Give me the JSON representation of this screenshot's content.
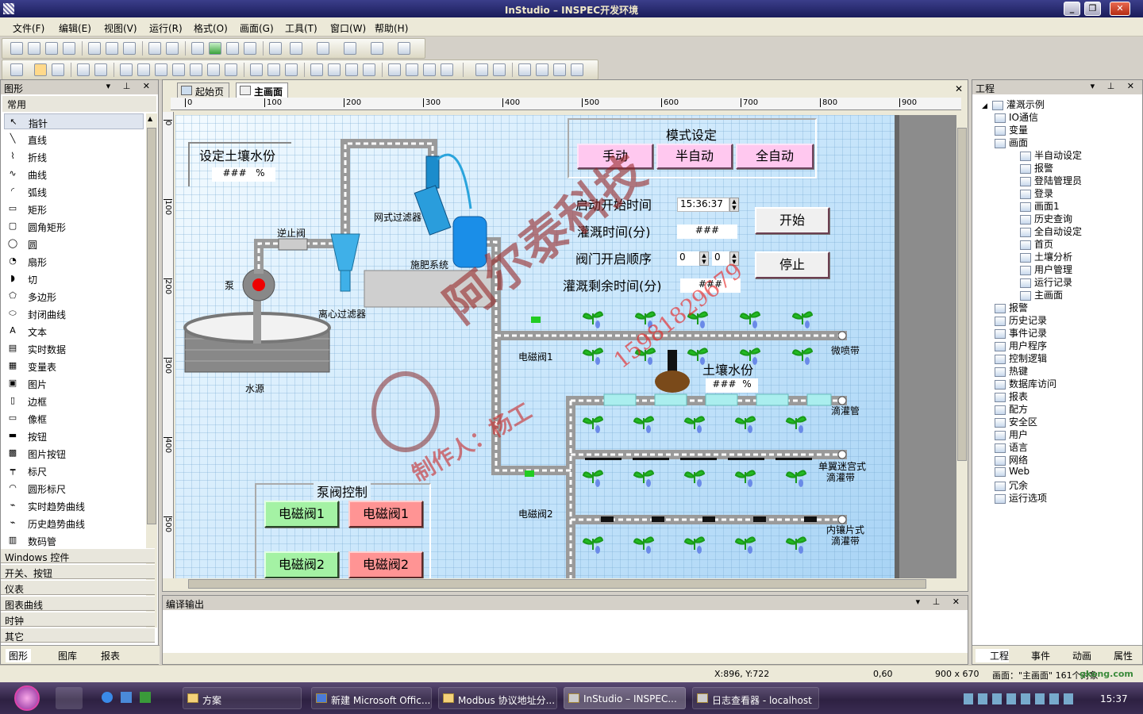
{
  "window": {
    "title": "InStudio – INSPEC开发环境"
  },
  "menu": [
    "文件(F)",
    "编辑(E)",
    "视图(V)",
    "运行(R)",
    "格式(O)",
    "画面(G)",
    "工具(T)",
    "窗口(W)",
    "帮助(H)"
  ],
  "left_panel": {
    "title": "图形",
    "category_open": "常用",
    "tools": [
      {
        "label": "指针",
        "icon": "pointer-icon",
        "glyph": "↖"
      },
      {
        "label": "直线",
        "icon": "line-icon",
        "glyph": "╲"
      },
      {
        "label": "折线",
        "icon": "polyline-icon",
        "glyph": "⌇"
      },
      {
        "label": "曲线",
        "icon": "curve-icon",
        "glyph": "∿"
      },
      {
        "label": "弧线",
        "icon": "arc-icon",
        "glyph": "◜"
      },
      {
        "label": "矩形",
        "icon": "rectangle-icon",
        "glyph": "▭"
      },
      {
        "label": "圆角矩形",
        "icon": "rounded-rect-icon",
        "glyph": "▢"
      },
      {
        "label": "圆",
        "icon": "circle-icon",
        "glyph": "◯"
      },
      {
        "label": "扇形",
        "icon": "sector-icon",
        "glyph": "◔"
      },
      {
        "label": "切",
        "icon": "chord-icon",
        "glyph": "◗"
      },
      {
        "label": "多边形",
        "icon": "polygon-icon",
        "glyph": "⬠"
      },
      {
        "label": "封闭曲线",
        "icon": "closed-curve-icon",
        "glyph": "⬭"
      },
      {
        "label": "文本",
        "icon": "text-icon",
        "glyph": "A"
      },
      {
        "label": "实时数据",
        "icon": "realtime-data-icon",
        "glyph": "▤"
      },
      {
        "label": "变量表",
        "icon": "variable-table-icon",
        "glyph": "▦"
      },
      {
        "label": "图片",
        "icon": "picture-icon",
        "glyph": "▣"
      },
      {
        "label": "边框",
        "icon": "border-icon",
        "glyph": "▯"
      },
      {
        "label": "像框",
        "icon": "frame-icon",
        "glyph": "▭"
      },
      {
        "label": "按钮",
        "icon": "button-icon",
        "glyph": "▬"
      },
      {
        "label": "图片按钮",
        "icon": "picture-button-icon",
        "glyph": "▩"
      },
      {
        "label": "标尺",
        "icon": "ruler-icon",
        "glyph": "┯"
      },
      {
        "label": "圆形标尺",
        "icon": "round-ruler-icon",
        "glyph": "◠"
      },
      {
        "label": "实时趋势曲线",
        "icon": "realtime-trend-icon",
        "glyph": "⌁"
      },
      {
        "label": "历史趋势曲线",
        "icon": "history-trend-icon",
        "glyph": "⌁"
      },
      {
        "label": "数码管",
        "icon": "digital-tube-icon",
        "glyph": "▥"
      }
    ],
    "categories": [
      "Windows 控件",
      "开关、按钮",
      "仪表",
      "图表曲线",
      "时钟",
      "其它"
    ],
    "bottom_tabs": [
      "图形",
      "图库",
      "报表"
    ]
  },
  "doc_tabs": [
    "起始页",
    "主画面"
  ],
  "ruler_marks": [
    "0",
    "100",
    "200",
    "300",
    "400",
    "500",
    "600",
    "700",
    "800",
    "900"
  ],
  "vruler_marks": [
    "0",
    "100",
    "200",
    "300",
    "400",
    "500"
  ],
  "scada": {
    "soil_set": {
      "title": "设定土壤水份",
      "value": "###",
      "unit": "%"
    },
    "mode": {
      "title": "模式设定",
      "buttons": [
        "手动",
        "半自动",
        "全自动"
      ]
    },
    "start_time": {
      "label": "启动开始时间",
      "value": "15:36:37"
    },
    "irrigation_time": {
      "label": "灌溉时间(分)",
      "value": "###"
    },
    "valve_order": {
      "label": "阀门开启顺序",
      "v1": "0",
      "v2": "0"
    },
    "remaining": {
      "label": "灌溉剩余时间(分)",
      "value": "###"
    },
    "start_button": "开始",
    "stop_button": "停止",
    "labels": {
      "check_valve": "逆止阀",
      "mesh_filter": "网式过滤器",
      "fertilizer": "施肥系统",
      "pump": "泵",
      "centrifugal": "离心过滤器",
      "water_source": "水源",
      "sv1": "电磁阀1",
      "sv2": "电磁阀2",
      "micro_spray": "微喷带",
      "drip_pipe": "滴灌管",
      "single_wing_1": "单翼迷宫式",
      "single_wing_2": "滴灌带",
      "inner_1": "内镶片式",
      "inner_2": "滴灌带"
    },
    "soil_moisture": {
      "label": "土壤水份",
      "value": "###",
      "unit": "%"
    },
    "pump_valve_control": {
      "title": "泵阀控制",
      "buttons": [
        "电磁阀1",
        "电磁阀1",
        "电磁阀2",
        "电磁阀2"
      ]
    },
    "watermark": {
      "company": "阿尔泰科技",
      "author": "制作人：杨工",
      "phone": "15981829679"
    }
  },
  "output_panel": {
    "title": "编译输出"
  },
  "right_panel": {
    "title": "工程",
    "root": "灌溉示例",
    "items": [
      {
        "label": "IO通信",
        "level": 1
      },
      {
        "label": "变量",
        "level": 1
      },
      {
        "label": "画面",
        "level": 1
      },
      {
        "label": "半自动设定",
        "level": 2
      },
      {
        "label": "报警",
        "level": 2
      },
      {
        "label": "登陆管理员",
        "level": 2
      },
      {
        "label": "登录",
        "level": 2
      },
      {
        "label": "画面1",
        "level": 2
      },
      {
        "label": "历史查询",
        "level": 2
      },
      {
        "label": "全自动设定",
        "level": 2
      },
      {
        "label": "首页",
        "level": 2
      },
      {
        "label": "土壤分析",
        "level": 2
      },
      {
        "label": "用户管理",
        "level": 2
      },
      {
        "label": "运行记录",
        "level": 2
      },
      {
        "label": "主画面",
        "level": 2
      },
      {
        "label": "报警",
        "level": 1
      },
      {
        "label": "历史记录",
        "level": 1
      },
      {
        "label": "事件记录",
        "level": 1
      },
      {
        "label": "用户程序",
        "level": 1
      },
      {
        "label": "控制逻辑",
        "level": 1
      },
      {
        "label": "热键",
        "level": 1
      },
      {
        "label": "数据库访问",
        "level": 1
      },
      {
        "label": "报表",
        "level": 1
      },
      {
        "label": "配方",
        "level": 1
      },
      {
        "label": "安全区",
        "level": 1
      },
      {
        "label": "用户",
        "level": 1
      },
      {
        "label": "语言",
        "level": 1
      },
      {
        "label": "网络",
        "level": 1
      },
      {
        "label": "Web",
        "level": 1
      },
      {
        "label": "冗余",
        "level": 1
      },
      {
        "label": "运行选项",
        "level": 1
      }
    ],
    "bottom_tabs": [
      "工程",
      "事件",
      "动画",
      "属性"
    ]
  },
  "statusbar": {
    "coords": "X:896, Y:722",
    "pos": "0,60",
    "size": "900 x 670",
    "info": "画面：\"主画面\" 161个对象",
    "site": "gkong.com"
  },
  "taskbar": {
    "tasks": [
      "方案",
      "新建 Microsoft Offic...",
      "Modbus 协议地址分...",
      "InStudio – INSPEC...",
      "日志查看器 - localhost"
    ],
    "clock": "15:37"
  },
  "colors": {
    "pipe": "#9a9a9a",
    "canvas": "#c9e6fb",
    "title": "#1a1c5a",
    "watermark": "#a03030"
  }
}
